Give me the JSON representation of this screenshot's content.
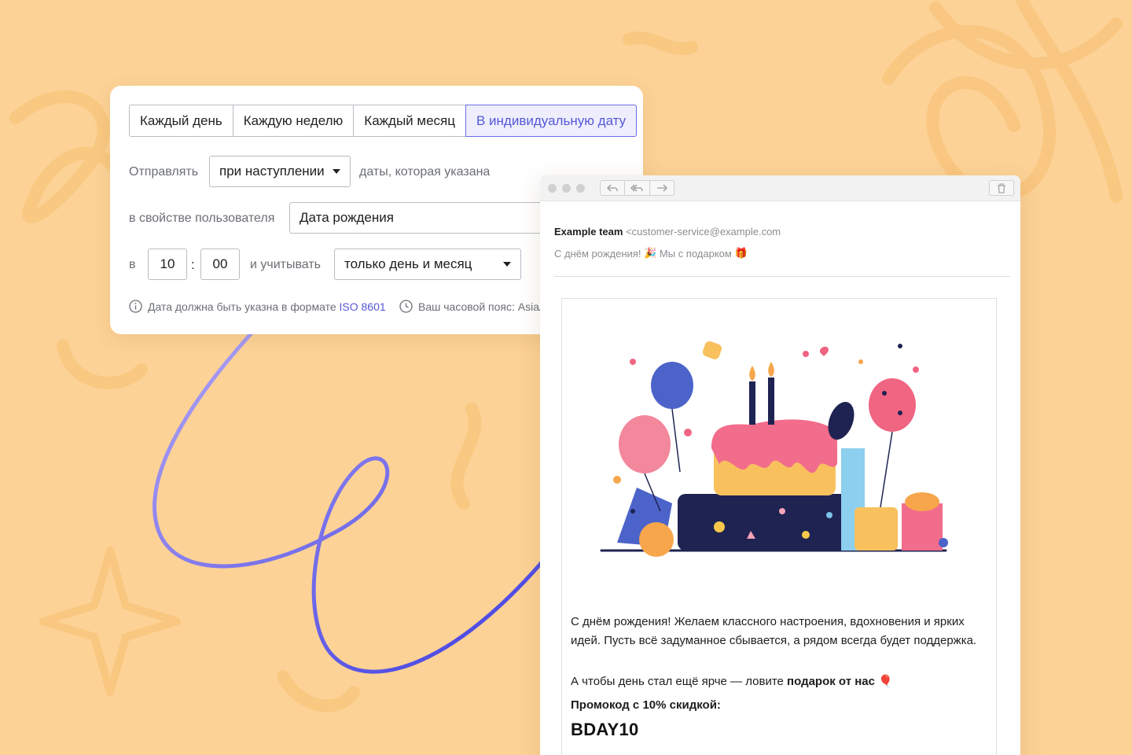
{
  "scheduler": {
    "tabs": [
      {
        "label": "Каждый день",
        "active": false
      },
      {
        "label": "Каждую неделю",
        "active": false
      },
      {
        "label": "Каждый месяц",
        "active": false
      },
      {
        "label": "В индивидуальную дату",
        "active": true
      }
    ],
    "send_label": "Отправлять",
    "send_mode": "при наступлении",
    "date_label": "даты, которая указана",
    "property_label": "в свойстве пользователя",
    "property_value": "Дата рождения",
    "at_label": "в",
    "hour": "10",
    "colon": ":",
    "minute": "00",
    "consider_label": "и учитывать",
    "consider_value": "только день и месяц",
    "hint_date_text": "Дата должна быть указна в формате",
    "hint_date_link": "ISO 8601",
    "hint_timezone": "Ваш часовой пояс: Asia/"
  },
  "email": {
    "sender_name": "Example team",
    "sender_email": "<customer-service@example.com",
    "subject_part1": "С днём рождения!",
    "subject_emoji1": "🎉",
    "subject_part2": "Мы с подарком",
    "subject_emoji2": "🎁",
    "body_line1": "С днём рождения! Желаем классного настроения, вдохновения и ярких",
    "body_line2": "идей. Пусть всё задуманное сбывается, а рядом всегда будет поддержка.",
    "body_line3_prefix": "А чтобы день стал ещё ярче — ловите",
    "body_line3_bold": "подарок от нас",
    "body_line3_emoji": "🎈",
    "promo_label": "Промокод с 10% скидкой:",
    "promo_code": "BDAY10"
  },
  "colors": {
    "background": "#fcd296",
    "accent": "#5558d8",
    "arrow_start": "#b3a5f5",
    "arrow_end": "#3a3ae0"
  },
  "icons": [
    "info-icon",
    "clock-icon",
    "reply-icon",
    "reply-all-icon",
    "forward-icon",
    "trash-icon"
  ]
}
